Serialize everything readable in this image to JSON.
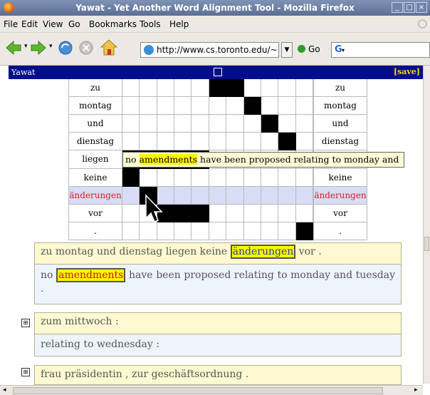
{
  "window": {
    "title": "Yawat - Yet Another Word Alignment Tool - Mozilla Firefox"
  },
  "menu": [
    {
      "label": "File"
    },
    {
      "label": "Edit"
    },
    {
      "label": "View"
    },
    {
      "label": "Go"
    },
    {
      "label": "Bookmarks"
    },
    {
      "label": "Tools"
    },
    {
      "label": "Help"
    }
  ],
  "nav": {
    "url": "http://www.cs.toronto.edu/~",
    "go_label": "Go",
    "search_value": ""
  },
  "yawat": {
    "label": "Yawat",
    "save_label": "[save]"
  },
  "matrix": {
    "row_labels": [
      "zu",
      "montag",
      "und",
      "dienstag",
      "liegen",
      "keine",
      "änderungen",
      "vor",
      "."
    ],
    "highlighted_row": 6,
    "highlight_color": "#d8dcf6",
    "alignments": [
      [
        0,
        5
      ],
      [
        0,
        6
      ],
      [
        1,
        7
      ],
      [
        2,
        8
      ],
      [
        3,
        9
      ],
      [
        4,
        0
      ],
      [
        4,
        1
      ],
      [
        4,
        2
      ],
      [
        4,
        3
      ],
      [
        4,
        4
      ],
      [
        5,
        0
      ],
      [
        6,
        1
      ],
      [
        7,
        2
      ],
      [
        7,
        3
      ],
      [
        7,
        4
      ],
      [
        8,
        10
      ]
    ],
    "tooltip": {
      "before": "no ",
      "highlight": "amendments",
      "after": " have been proposed relating to monday and"
    }
  },
  "sentences": [
    {
      "src_before": "zu montag und dienstag liegen keine ",
      "src_highlight": "änderungen",
      "src_after": " vor .",
      "tgt_before": "no ",
      "tgt_highlight": "amendments",
      "tgt_after": " have been proposed relating to monday and tuesday ."
    },
    {
      "src": "zum mittwoch :",
      "tgt": "relating to wednesday :"
    },
    {
      "src": "frau präsidentin , zur geschäftsordnung ."
    }
  ]
}
